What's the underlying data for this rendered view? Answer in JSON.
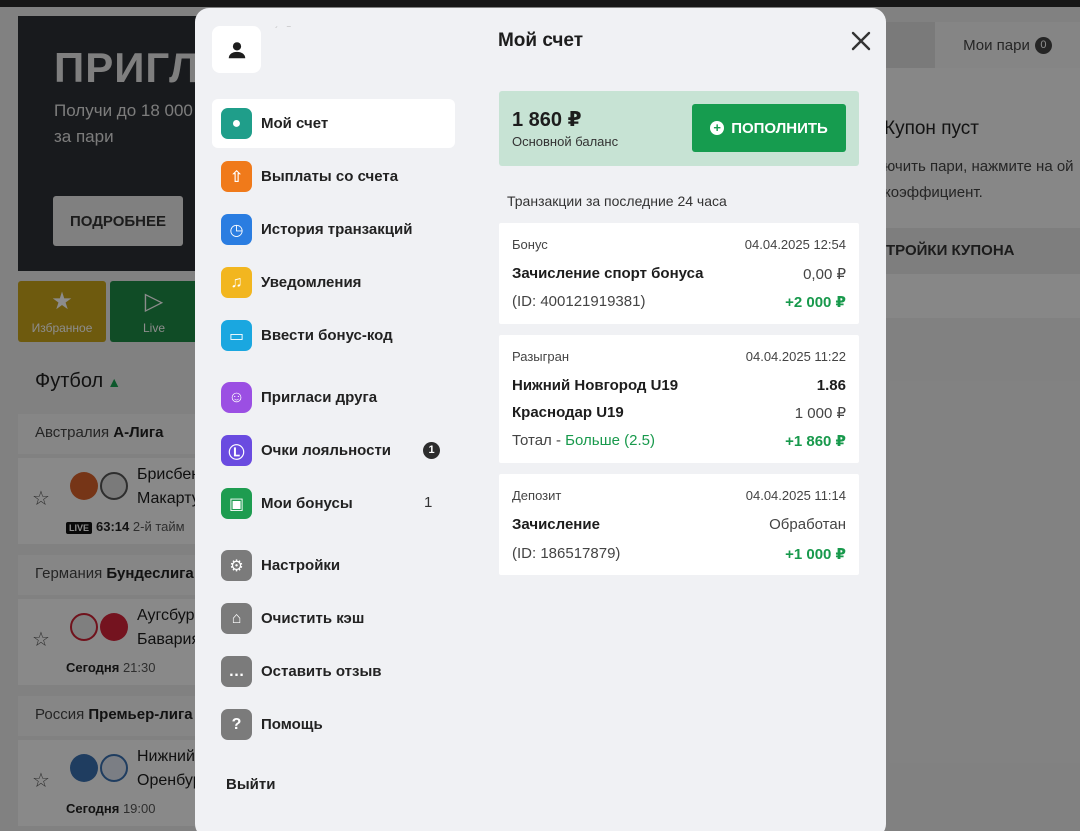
{
  "background": {
    "banner": {
      "title": "ПРИГЛАС",
      "subtitle": "Получи до 18 000 за пари",
      "button": "ПОДРОБНЕЕ"
    },
    "tiles": [
      {
        "icon": "star-icon",
        "label": "Избранное"
      },
      {
        "icon": "play-icon",
        "label": "Live"
      }
    ],
    "sport": "Футбол",
    "leagues": [
      {
        "country": "Австралия",
        "name": "А-Лига",
        "team1": "Брисбен",
        "team2": "Макарту",
        "live": "LIVE",
        "time": "63:14",
        "period": "2-й тайм"
      },
      {
        "country": "Германия",
        "name": "Бундеслига",
        "team1": "Аугсбур",
        "team2": "Бавария",
        "day": "Сегодня",
        "time": "21:30"
      },
      {
        "country": "Россия",
        "name": "Премьер-лига",
        "team1": "Нижний",
        "team2": "Оренбург",
        "day": "Сегодня",
        "time": "19:00"
      }
    ],
    "bets_tab": {
      "label": "Мои пари",
      "count": "0"
    },
    "coupon": {
      "title": "Купон пуст",
      "text": "ючить пари, нажмите на ой коэффициент.",
      "settings": "ТРОЙКИ КУПОНА"
    }
  },
  "modal": {
    "title": "Мой счет",
    "menu": [
      {
        "label": "Мой счет",
        "icon": "account-icon",
        "color": "#1f9e8a"
      },
      {
        "label": "Выплаты со счета",
        "icon": "withdraw-icon",
        "color": "#f07a1a"
      },
      {
        "label": "История транзакций",
        "icon": "clock-icon",
        "color": "#2a7de1"
      },
      {
        "label": "Уведомления",
        "icon": "bell-icon",
        "color": "#f2b61f"
      },
      {
        "label": "Ввести бонус-код",
        "icon": "ticket-icon",
        "color": "#1aa7e0"
      },
      {
        "label": "Пригласи друга",
        "icon": "friends-icon",
        "color": "#9b4fe3"
      },
      {
        "label": "Очки лояльности",
        "icon": "loyalty-icon",
        "color": "#6a4be0",
        "badge": "1"
      },
      {
        "label": "Мои бонусы",
        "icon": "gift-icon",
        "color": "#1e9c50",
        "count": "1"
      },
      {
        "label": "Настройки",
        "icon": "gear-icon",
        "color": "#7b7b7b"
      },
      {
        "label": "Очистить кэш",
        "icon": "broom-icon",
        "color": "#7b7b7b"
      },
      {
        "label": "Оставить отзыв",
        "icon": "chat-icon",
        "color": "#7b7b7b"
      },
      {
        "label": "Помощь",
        "icon": "help-icon",
        "color": "#7b7b7b"
      }
    ],
    "logout": "Выйти",
    "balance": {
      "amount": "1 860 ₽",
      "label": "Основной баланс",
      "button": "ПОПОЛНИТЬ"
    },
    "transactions_header": "Транзакции за последние 24 часа",
    "transactions": [
      {
        "type": "Бонус",
        "date": "04.04.2025 12:54",
        "title": "Зачисление спорт бонуса",
        "title_value": "0,00 ₽",
        "detail": "(ID: 400121919381)",
        "amount": "+2 000 ₽"
      },
      {
        "type": "Разыгран",
        "date": "04.04.2025 11:22",
        "team1": "Нижний Новгород U19",
        "odds": "1.86",
        "team2": "Краснодар U19",
        "stake": "1 000 ₽",
        "market": "Тотал - ",
        "selection": "Больше (2.5)",
        "amount": "+1 860 ₽"
      },
      {
        "type": "Депозит",
        "date": "04.04.2025 11:14",
        "title": "Зачисление",
        "title_value": "Обработан",
        "detail": "(ID: 186517879)",
        "amount": "+1 000 ₽"
      }
    ]
  }
}
